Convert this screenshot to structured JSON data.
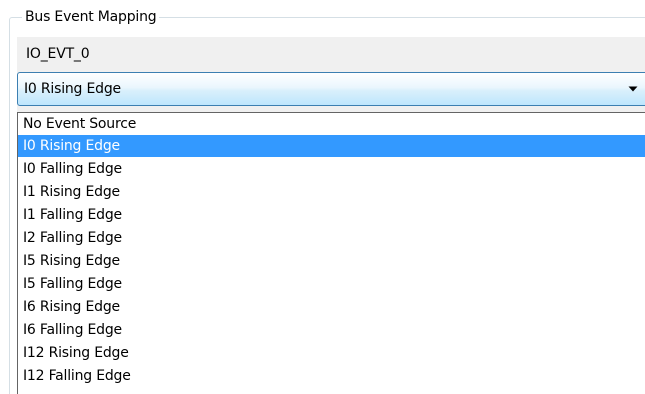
{
  "group": {
    "title": "Bus Event Mapping"
  },
  "field": {
    "label": "IO_EVT_0"
  },
  "combo": {
    "value": "I0 Rising Edge",
    "arrow_icon": "dropdown-arrow-icon"
  },
  "list": {
    "selected_index": 1,
    "highlight_color": "#3399ff",
    "options": [
      "No Event Source",
      "I0 Rising Edge",
      "I0 Falling Edge",
      "I1 Rising Edge",
      "I1 Falling Edge",
      "I2 Falling Edge",
      "I5 Rising Edge",
      "I5 Falling Edge",
      "I6 Rising Edge",
      "I6 Falling Edge",
      "I12 Rising Edge",
      "I12 Falling Edge"
    ]
  }
}
